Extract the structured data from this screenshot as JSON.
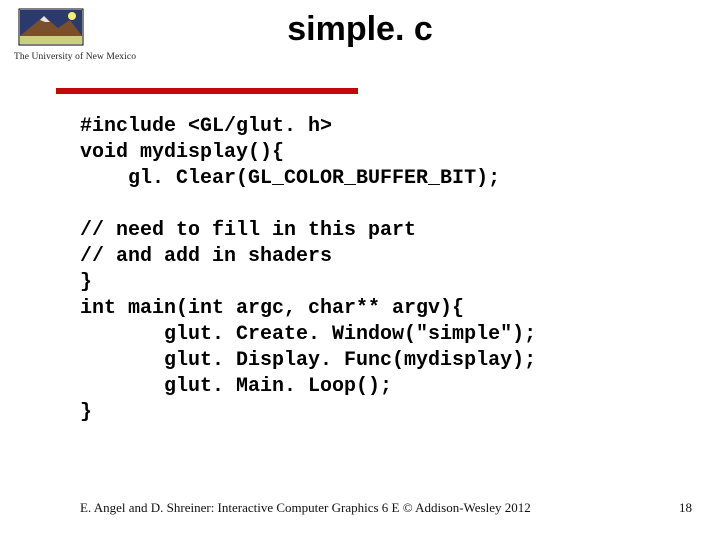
{
  "logo": {
    "caption": "The University of New Mexico"
  },
  "title": "simple. c",
  "code": "#include <GL/glut. h>\nvoid mydisplay(){\n    gl. Clear(GL_COLOR_BUFFER_BIT);\n\n// need to fill in this part\n// and add in shaders\n}\nint main(int argc, char** argv){\n       glut. Create. Window(\"simple\");\n       glut. Display. Func(mydisplay);\n       glut. Main. Loop();\n}",
  "footer": "E. Angel and D. Shreiner: Interactive Computer Graphics 6 E © Addison-Wesley 2012",
  "page_number": "18",
  "colors": {
    "accent_red": "#c30808"
  }
}
